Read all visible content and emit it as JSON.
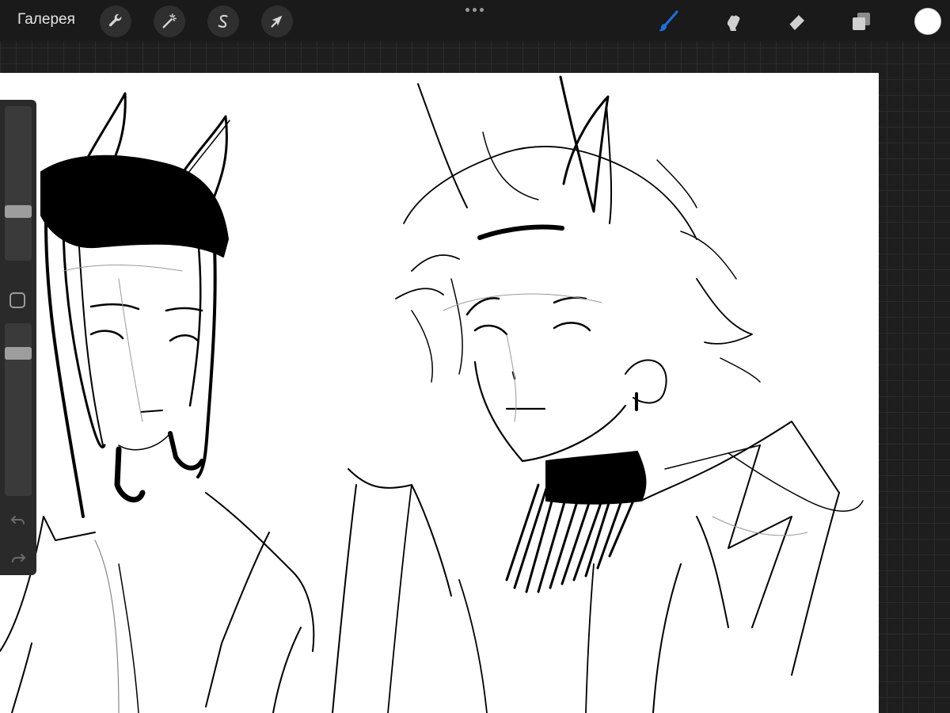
{
  "topbar": {
    "gallery_label": "Галерея",
    "left_tools": [
      "wrench-icon",
      "magic-wand-icon",
      "selection-s-icon",
      "transform-arrow-icon"
    ],
    "more_icon": "more-dots-icon",
    "right_tools": [
      "brush-icon",
      "smudge-icon",
      "eraser-icon",
      "layers-icon"
    ],
    "active_tool": "brush-icon",
    "active_tool_color": "#1e6fd9",
    "current_color": "#ffffff"
  },
  "sidebar": {
    "brush_size_level": 0.3,
    "opacity_level": 0.85,
    "icons": [
      "modifier-square-icon",
      "undo-icon",
      "redo-icon"
    ]
  },
  "canvas": {
    "background": "#ffffff",
    "content": "sketch-artwork"
  }
}
